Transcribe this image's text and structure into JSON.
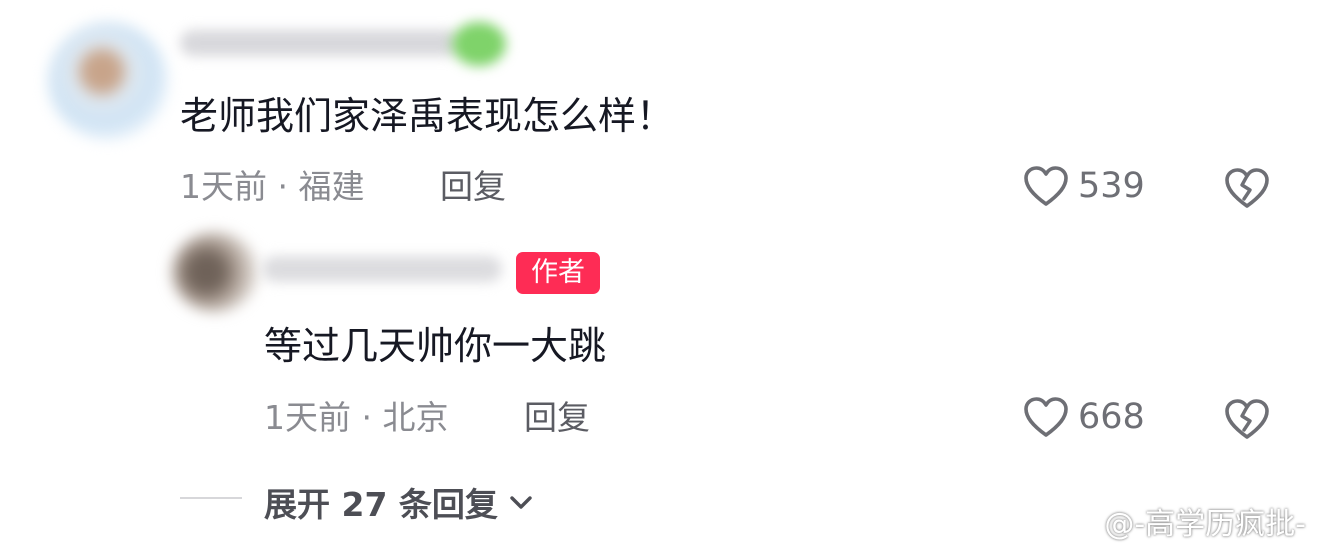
{
  "comment": {
    "text": "老师我们家泽禹表现怎么样！",
    "meta": "1天前 · 福建",
    "reply_label": "回复",
    "likes": "539",
    "icons": {
      "like": "heart-outline-icon",
      "dislike": "broken-heart-icon"
    }
  },
  "reply": {
    "author_tag": "作者",
    "text": "等过几天帅你一大跳",
    "meta": "1天前 · 北京",
    "reply_label": "回复",
    "likes": "668"
  },
  "expand": {
    "label": "展开 27 条回复",
    "icon": "chevron-down-icon"
  },
  "watermark": {
    "text": "@-高学历疯批-",
    "icon": "weibo-logo-icon"
  },
  "colors": {
    "accent": "#fe2c55",
    "text_primary": "#161823",
    "text_secondary": "#8a8b91"
  }
}
